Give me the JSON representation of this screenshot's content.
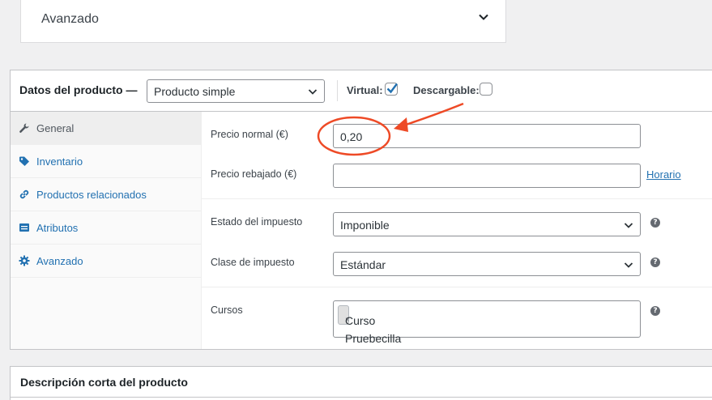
{
  "top_section": {
    "label": "Avanzado",
    "icon": "chevron-down-icon"
  },
  "product_data": {
    "title": "Datos del producto —",
    "type_select": {
      "value": "Producto simple"
    },
    "virtual": {
      "label": "Virtual:",
      "checked": true
    },
    "downloadable": {
      "label": "Descargable:",
      "checked": false
    },
    "tabs": [
      {
        "label": "General",
        "icon": "wrench-icon",
        "active": true
      },
      {
        "label": "Inventario",
        "icon": "tag-icon",
        "active": false
      },
      {
        "label": "Productos relacionados",
        "icon": "link-icon",
        "active": false
      },
      {
        "label": "Atributos",
        "icon": "list-icon",
        "active": false
      },
      {
        "label": "Avanzado",
        "icon": "gear-icon",
        "active": false
      }
    ],
    "fields": {
      "regular_price": {
        "label": "Precio normal (€)",
        "value": "0,20"
      },
      "sale_price": {
        "label": "Precio rebajado (€)",
        "value": "",
        "link": "Horario"
      },
      "tax_status": {
        "label": "Estado del impuesto",
        "value": "Imponible"
      },
      "tax_class": {
        "label": "Clase de impuesto",
        "value": "Estándar"
      },
      "courses": {
        "label": "Cursos",
        "tokens": [
          {
            "x": "×",
            "label": "Curso Pruebecilla"
          }
        ]
      }
    },
    "help_glyph": "?"
  },
  "short_description": {
    "title": "Descripción corta del producto"
  },
  "annotation": {
    "color": "#ee4a26"
  },
  "colors": {
    "link": "#2271b1",
    "checkbox_check": "#2271b1"
  }
}
